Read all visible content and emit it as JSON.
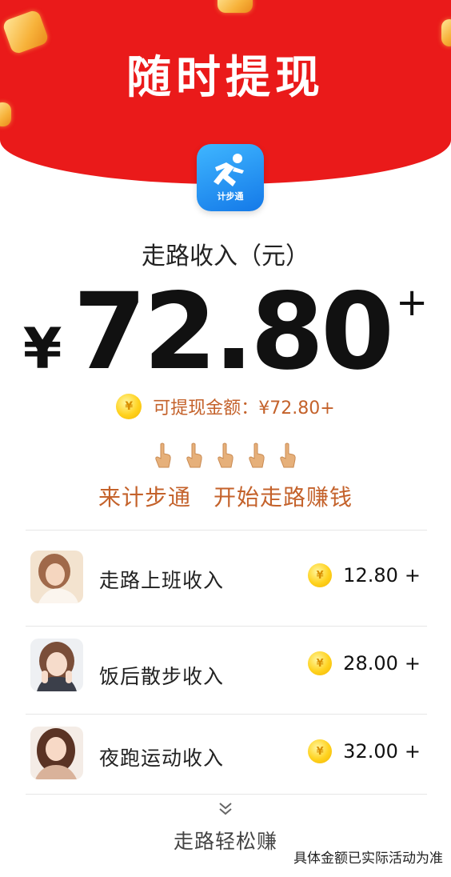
{
  "header": {
    "title": "随时提现"
  },
  "app": {
    "icon_label": "计步通"
  },
  "income": {
    "label": "走路收入（元）",
    "currency": "¥",
    "amount": "72.80",
    "plus": "+"
  },
  "withdraw": {
    "coin_glyph": "¥",
    "text": "可提现金额：¥72.80+"
  },
  "cta": {
    "left": "来计步通",
    "right": "开始走路赚钱"
  },
  "rows": [
    {
      "label": "走路上班收入",
      "value": "12.80",
      "plus": "+",
      "coin_glyph": "¥"
    },
    {
      "label": "饭后散步收入",
      "value": "28.00",
      "plus": "+",
      "coin_glyph": "¥"
    },
    {
      "label": "夜跑运动收入",
      "value": "32.00",
      "plus": "+",
      "coin_glyph": "¥"
    }
  ],
  "footer": {
    "more_label": "走路轻松赚",
    "disclaimer": "具体金额已实际活动为准"
  },
  "colors": {
    "header_red": "#ea1a1a",
    "accent_brown": "#c4622b",
    "coin_gold": "#ffd21e",
    "app_blue": "#1479e8"
  },
  "icons": [
    "runner-app-icon",
    "coin-icon",
    "pointing-hand-icon",
    "double-chevron-down-icon"
  ]
}
